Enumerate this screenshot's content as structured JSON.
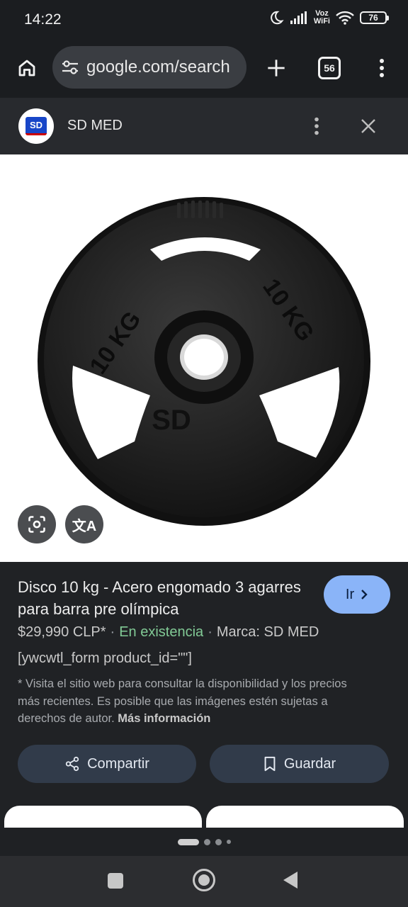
{
  "status": {
    "time": "14:22",
    "voz": "Voz",
    "wifi_label": "WiFi",
    "battery": "76"
  },
  "browser": {
    "url": "google.com/search",
    "tab_count": "56"
  },
  "site": {
    "logo_text": "SD",
    "name": "SD MED"
  },
  "image": {
    "plate_label_left": "10 KG",
    "plate_label_right": "10 KG",
    "plate_brand": "SD",
    "translate_glyph": "文A"
  },
  "product": {
    "title": "Disco 10 kg - Acero engomado 3 agarres para barra pre olímpica",
    "go_label": "Ir",
    "price": "$29,990 CLP*",
    "stock": "En existencia",
    "brand": "Marca: SD MED",
    "shortcode": "[ywcwtl_form product_id=\"\"]",
    "disclaimer": "* Visita el sitio web para consultar la disponibilidad y los precios más recientes. Es posible que las imágenes estén sujetas a derechos de autor.",
    "more_info": "Más información",
    "share_label": "Compartir",
    "save_label": "Guardar"
  },
  "pager": {
    "pages": 4,
    "active": 1
  },
  "icons": [
    "dnd-moon-icon",
    "signal-icon",
    "wifi-icon",
    "battery-icon",
    "home-icon",
    "tune-icon",
    "plus-icon",
    "tabs-icon",
    "more-vert-icon",
    "close-icon",
    "lens-icon",
    "translate-icon",
    "chevron-right-icon",
    "share-icon",
    "bookmark-icon"
  ]
}
